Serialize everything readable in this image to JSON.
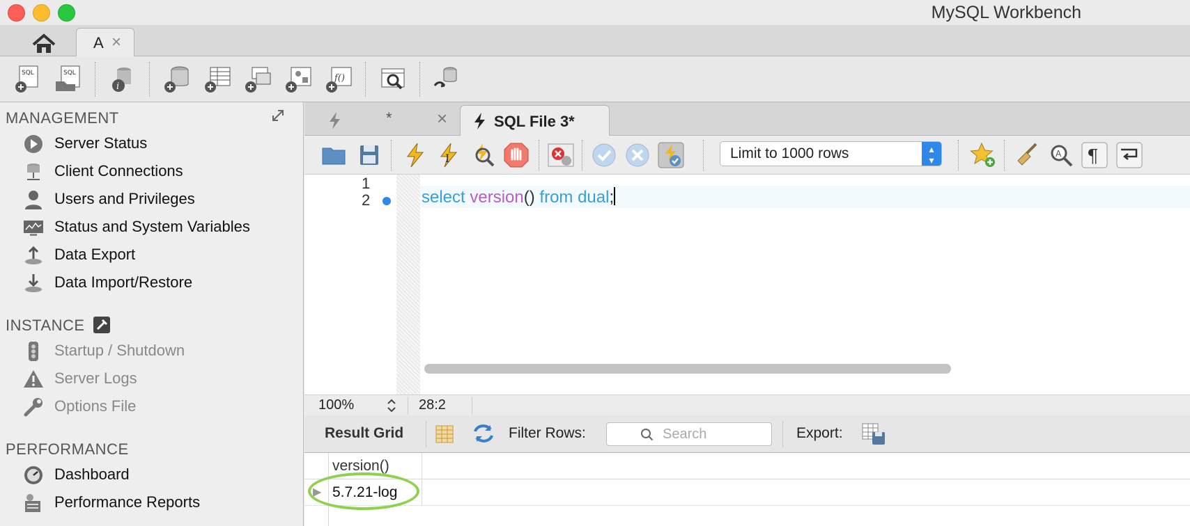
{
  "window": {
    "title": "MySQL Workbench"
  },
  "tabs": {
    "connection_label": "A",
    "close_glyph": "×"
  },
  "sidebar": {
    "management_title": "MANAGEMENT",
    "management_items": [
      {
        "label": "Server Status",
        "icon": "play-circle-icon"
      },
      {
        "label": "Client Connections",
        "icon": "network-icon"
      },
      {
        "label": "Users and Privileges",
        "icon": "user-icon"
      },
      {
        "label": "Status and System Variables",
        "icon": "monitor-icon"
      },
      {
        "label": "Data Export",
        "icon": "export-icon"
      },
      {
        "label": "Data Import/Restore",
        "icon": "import-icon"
      }
    ],
    "instance_title": "INSTANCE",
    "instance_items": [
      {
        "label": "Startup / Shutdown",
        "icon": "traffic-light-icon"
      },
      {
        "label": "Server Logs",
        "icon": "warning-icon"
      },
      {
        "label": "Options File",
        "icon": "wrench-icon"
      }
    ],
    "performance_title": "PERFORMANCE",
    "performance_items": [
      {
        "label": "Dashboard",
        "icon": "gauge-icon"
      },
      {
        "label": "Performance Reports",
        "icon": "reports-icon"
      }
    ]
  },
  "editor": {
    "tab_unsaved_mark": "*",
    "tab_close_glyph": "×",
    "active_tab_label": "SQL File 3*",
    "limit_select": "Limit to 1000 rows",
    "line_numbers": [
      "1",
      "2"
    ],
    "code": {
      "kw1": "select",
      "fn": "version",
      "paren": "()",
      "kw2": "from",
      "tbl": "dual",
      "end": ";"
    },
    "zoom": "100%",
    "cursor_pos": "28:2"
  },
  "results": {
    "grid_label": "Result Grid",
    "filter_label": "Filter Rows:",
    "search_placeholder": "Search",
    "export_label": "Export:",
    "columns": [
      "version()"
    ],
    "rows": [
      [
        "5.7.21-log"
      ]
    ]
  },
  "colors": {
    "accent": "#2f87ea",
    "keyword": "#3a9fd8",
    "function": "#b35fc5",
    "highlight_ring": "#8fd14f"
  }
}
